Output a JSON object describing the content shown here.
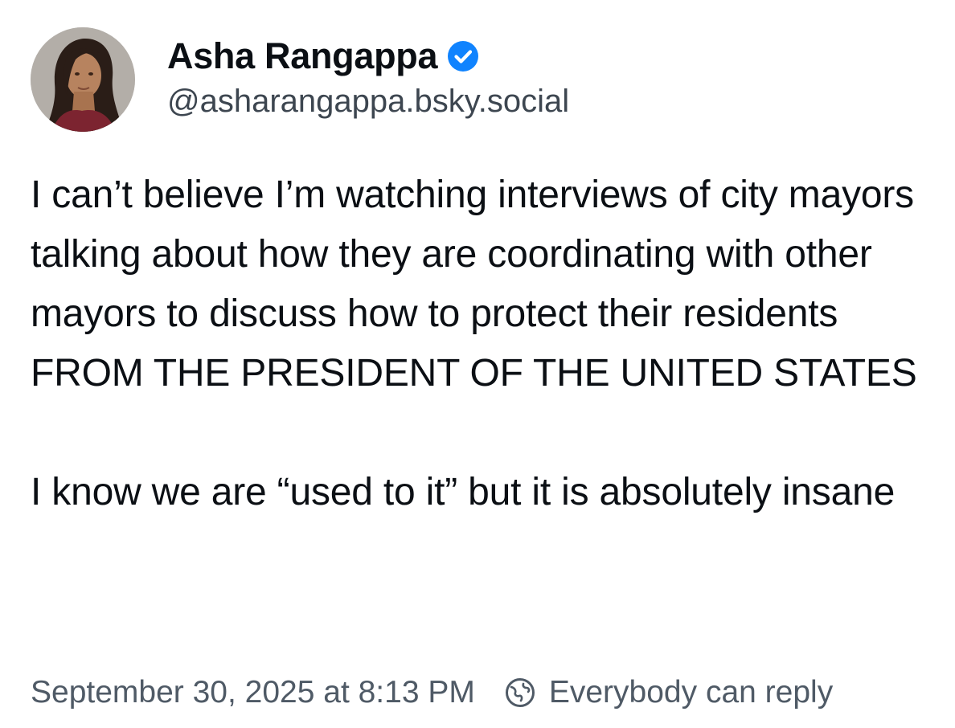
{
  "author": {
    "display_name": "Asha Rangappa",
    "handle": "@asharangappa.bsky.social",
    "verified": true,
    "verified_color": "#1083fe",
    "avatar_icon": "profile-photo"
  },
  "post": {
    "paragraphs": [
      "I can’t believe I’m watching interviews of city mayors talking about how they are coordinating with other mayors to discuss how to protect their residents FROM THE PRESIDENT OF THE UNITED STATES",
      "I know we are “used to it” but it is absolutely insane"
    ]
  },
  "meta": {
    "timestamp": "September 30, 2025 at 8:13 PM",
    "reply_setting": "Everybody can reply",
    "reply_icon": "globe-icon"
  }
}
